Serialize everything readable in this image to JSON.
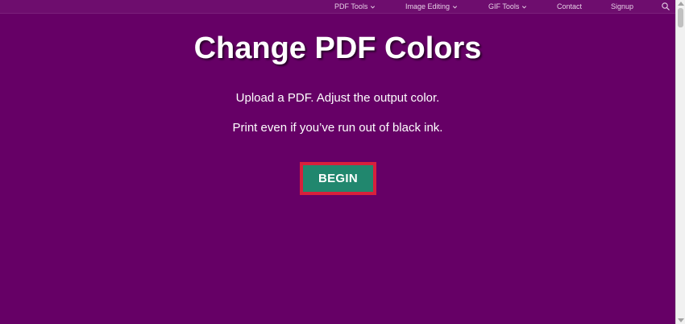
{
  "nav": {
    "items": [
      {
        "label": "PDF Tools",
        "has_dropdown": true
      },
      {
        "label": "Image Editing",
        "has_dropdown": true
      },
      {
        "label": "GIF Tools",
        "has_dropdown": true
      },
      {
        "label": "Contact",
        "has_dropdown": false
      },
      {
        "label": "Signup",
        "has_dropdown": false
      }
    ],
    "search_icon": "search-icon"
  },
  "hero": {
    "title": "Change PDF Colors",
    "line1": "Upload a PDF. Adjust the output color.",
    "line2": "Print even if you’ve run out of black ink.",
    "button_label": "BEGIN"
  },
  "colors": {
    "background": "#660066",
    "button": "#21876e",
    "button_highlight": "#d8203c"
  }
}
